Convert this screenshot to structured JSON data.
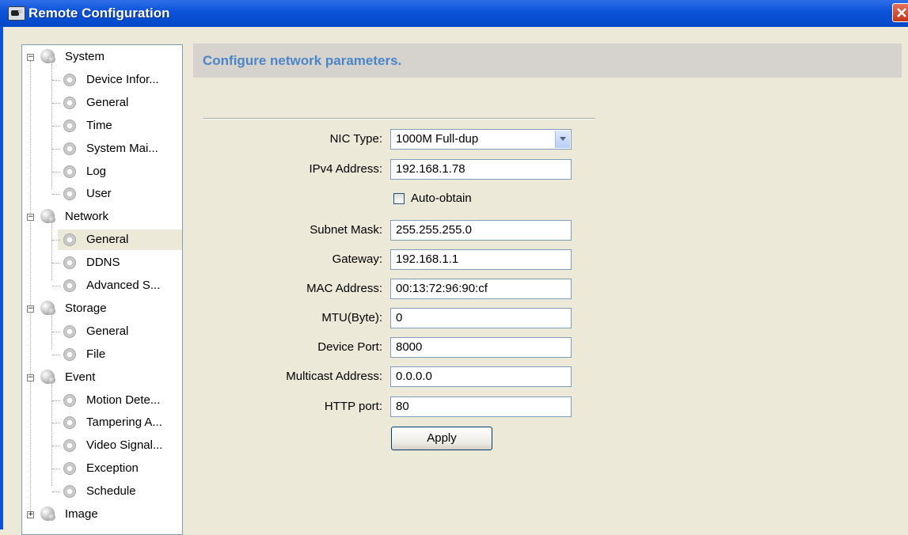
{
  "window": {
    "title": "Remote Configuration",
    "close_symbol": "×"
  },
  "tree": {
    "groups": [
      {
        "label": "System",
        "expander": "−",
        "children": [
          "Device Infor...",
          "General",
          "Time",
          "System Mai...",
          "Log",
          "User"
        ]
      },
      {
        "label": "Network",
        "expander": "−",
        "children": [
          "General",
          "DDNS",
          "Advanced S..."
        ]
      },
      {
        "label": "Storage",
        "expander": "−",
        "children": [
          "General",
          "File"
        ]
      },
      {
        "label": "Event",
        "expander": "−",
        "children": [
          "Motion Dete...",
          "Tampering A...",
          "Video Signal...",
          "Exception",
          "Schedule"
        ]
      },
      {
        "label": "Image",
        "expander": "+",
        "children": []
      }
    ],
    "selected": "Network/General"
  },
  "panel": {
    "header": "Configure network parameters.",
    "nic_type": {
      "label": "NIC Type:",
      "value": "1000M Full-dup"
    },
    "ipv4": {
      "label": "IPv4 Address:",
      "value": "192.168.1.78"
    },
    "auto_obtain": {
      "label": "Auto-obtain",
      "checked": false
    },
    "subnet": {
      "label": "Subnet Mask:",
      "value": "255.255.255.0"
    },
    "gateway": {
      "label": "Gateway:",
      "value": "192.168.1.1"
    },
    "mac": {
      "label": "MAC Address:",
      "value": "00:13:72:96:90:cf"
    },
    "mtu": {
      "label": "MTU(Byte):",
      "value": "0"
    },
    "device_port": {
      "label": "Device Port:",
      "value": "8000"
    },
    "multicast": {
      "label": "Multicast Address:",
      "value": "0.0.0.0"
    },
    "http_port": {
      "label": "HTTP port:",
      "value": "80"
    },
    "apply_label": "Apply"
  },
  "icons": {
    "group": "globe-icon",
    "item": "gear-icon",
    "app": "camera-icon"
  },
  "colors": {
    "titlebar": "#0a52d8",
    "header_text": "#4a86c6",
    "window_bg": "#ece9d8"
  }
}
